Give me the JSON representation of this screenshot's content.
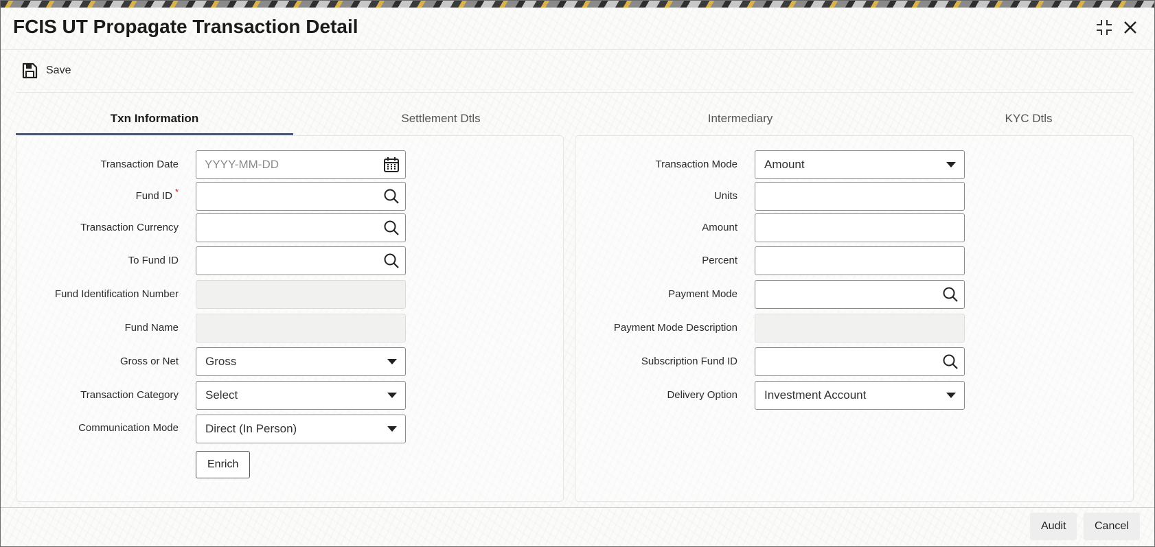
{
  "window": {
    "title": "FCIS UT Propagate Transaction Detail",
    "maximize_icon": "maximize-icon",
    "close_icon": "close-icon"
  },
  "toolbar": {
    "save_label": "Save",
    "save_icon": "save-icon"
  },
  "tabs": [
    {
      "label": "Txn Information",
      "active": true
    },
    {
      "label": "Settlement Dtls",
      "active": false
    },
    {
      "label": "Intermediary",
      "active": false
    },
    {
      "label": "KYC Dtls",
      "active": false
    }
  ],
  "left": {
    "transaction_date": {
      "label": "Transaction Date",
      "value": "",
      "placeholder": "YYYY-MM-DD",
      "icon": "calendar-icon"
    },
    "fund_id": {
      "label": "Fund ID",
      "required_mark": "*",
      "value": "",
      "icon": "search-icon"
    },
    "transaction_currency": {
      "label": "Transaction Currency",
      "value": "",
      "icon": "search-icon"
    },
    "to_fund_id": {
      "label": "To Fund ID",
      "value": "",
      "icon": "search-icon"
    },
    "fund_identification_number": {
      "label": "Fund Identification Number",
      "value": ""
    },
    "fund_name": {
      "label": "Fund Name",
      "value": ""
    },
    "gross_or_net": {
      "label": "Gross or Net",
      "value": "Gross"
    },
    "transaction_category": {
      "label": "Transaction Category",
      "value": "Select"
    },
    "communication_mode": {
      "label": "Communication Mode",
      "value": "Direct (In Person)"
    },
    "enrich_label": "Enrich"
  },
  "right": {
    "transaction_mode": {
      "label": "Transaction Mode",
      "value": "Amount"
    },
    "units": {
      "label": "Units",
      "value": ""
    },
    "amount": {
      "label": "Amount",
      "value": ""
    },
    "percent": {
      "label": "Percent",
      "value": ""
    },
    "payment_mode": {
      "label": "Payment Mode",
      "value": "",
      "icon": "search-icon"
    },
    "payment_mode_description": {
      "label": "Payment Mode Description",
      "value": ""
    },
    "subscription_fund_id": {
      "label": "Subscription Fund ID",
      "value": "",
      "icon": "search-icon"
    },
    "delivery_option": {
      "label": "Delivery Option",
      "value": "Investment Account"
    }
  },
  "footer": {
    "audit_label": "Audit",
    "cancel_label": "Cancel"
  },
  "colors": {
    "tab_active_underline": "#4a5a72",
    "required_mark": "#b02020"
  }
}
